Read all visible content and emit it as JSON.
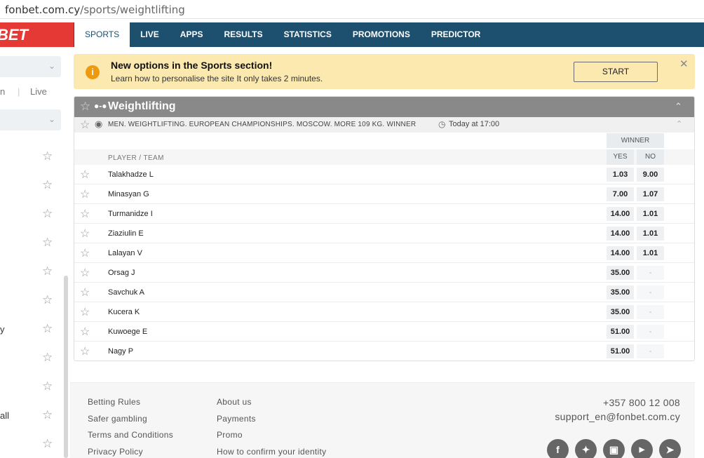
{
  "browser": {
    "url_host": "fonbet.com.cy",
    "url_path": "/sports/weightlifting"
  },
  "header": {
    "logo": "BET",
    "nav": [
      {
        "label": "SPORTS",
        "active": true
      },
      {
        "label": "LIVE"
      },
      {
        "label": "APPS"
      },
      {
        "label": "RESULTS"
      },
      {
        "label": "STATISTICS"
      },
      {
        "label": "PROMOTIONS"
      },
      {
        "label": "PREDICTOR"
      }
    ]
  },
  "sidebar": {
    "tab_left": "n",
    "tab_right": "Live",
    "row_labels": [
      "y",
      "all"
    ]
  },
  "promo": {
    "title": "New options in the Sports section!",
    "subtitle": "Learn how to personalise the site It only takes 2 minutes.",
    "button": "START"
  },
  "sport": {
    "name": "Weightlifting"
  },
  "event": {
    "name": "MEN. WEIGHTLIFTING. EUROPEAN CHAMPIONSHIPS. MOSCOW. MORE 109 KG. WINNER",
    "time": "Today at 17:00"
  },
  "market": {
    "title": "WINNER",
    "column_player": "PLAYER / TEAM",
    "column_yes": "YES",
    "column_no": "NO",
    "rows": [
      {
        "name": "Talakhadze L",
        "yes": "1.03",
        "no": "9.00"
      },
      {
        "name": "Minasyan G",
        "yes": "7.00",
        "no": "1.07"
      },
      {
        "name": "Turmanidze I",
        "yes": "14.00",
        "no": "1.01"
      },
      {
        "name": "Ziaziulin E",
        "yes": "14.00",
        "no": "1.01"
      },
      {
        "name": "Lalayan V",
        "yes": "14.00",
        "no": "1.01"
      },
      {
        "name": "Orsag J",
        "yes": "35.00",
        "no": "-"
      },
      {
        "name": "Savchuk A",
        "yes": "35.00",
        "no": "-"
      },
      {
        "name": "Kucera K",
        "yes": "35.00",
        "no": "-"
      },
      {
        "name": "Kuwoege E",
        "yes": "51.00",
        "no": "-"
      },
      {
        "name": "Nagy P",
        "yes": "51.00",
        "no": "-"
      }
    ]
  },
  "footer": {
    "col1": [
      "Betting Rules",
      "Safer gambling",
      "Terms and Conditions",
      "Privacy Policy"
    ],
    "col2": [
      "About us",
      "Payments",
      "Promo",
      "How to confirm your identity"
    ],
    "phone": "+357 800 12 008",
    "email": "support_en@fonbet.com.cy",
    "social_icons": [
      "facebook-icon",
      "twitter-icon",
      "instagram-icon",
      "youtube-icon",
      "telegram-icon"
    ]
  }
}
